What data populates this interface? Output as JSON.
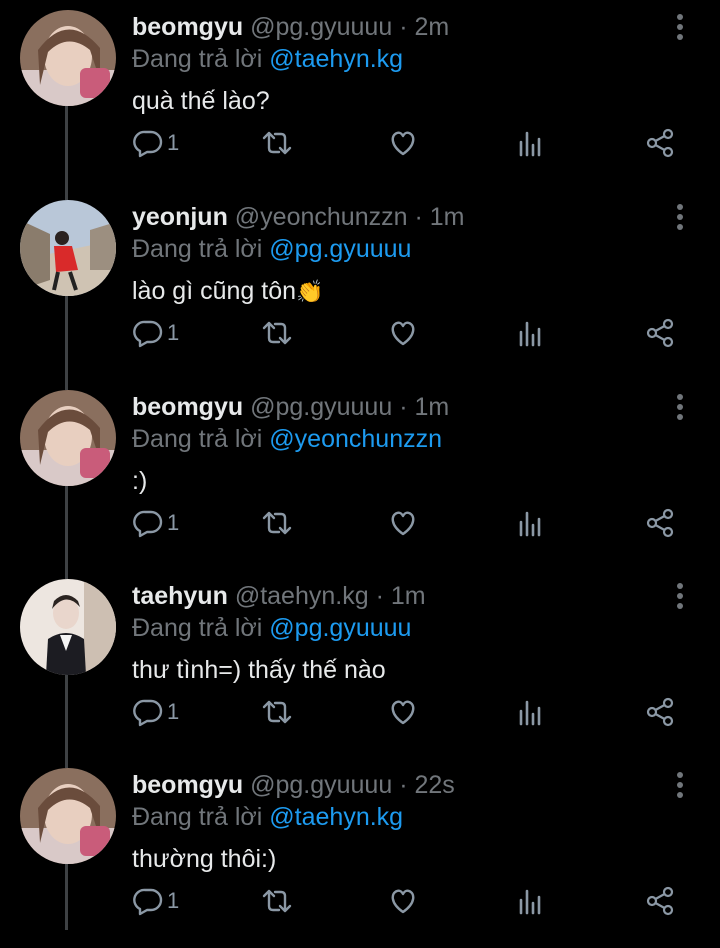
{
  "colors": {
    "background": "#000000",
    "text": "#e7e9ea",
    "muted": "#71767b",
    "mention": "#1d9bf0",
    "thread_line": "#3e4144"
  },
  "icons": [
    "reply-icon",
    "retweet-icon",
    "like-icon",
    "views-icon",
    "share-icon",
    "more-icon"
  ],
  "tweets": [
    {
      "name": "beomgyu",
      "handle": "@pg.gyuuuu",
      "sep": "·",
      "time": "2m",
      "reply_prefix": "Đang trả lời",
      "reply_to": "@taehyn.kg",
      "text": "quà thế lào?",
      "reply_count": "1"
    },
    {
      "name": "yeonjun",
      "handle": "@yeonchunzzn",
      "sep": "·",
      "time": "1m",
      "reply_prefix": "Đang trả lời",
      "reply_to": "@pg.gyuuuu",
      "text": "lào gì cũng tôn",
      "emoji": "👏",
      "reply_count": "1"
    },
    {
      "name": "beomgyu",
      "handle": "@pg.gyuuuu",
      "sep": "·",
      "time": "1m",
      "reply_prefix": "Đang trả lời",
      "reply_to": "@yeonchunzzn",
      "text": ":)",
      "reply_count": "1"
    },
    {
      "name": "taehyun",
      "handle": "@taehyn.kg",
      "sep": "·",
      "time": "1m",
      "reply_prefix": "Đang trả lời",
      "reply_to": "@pg.gyuuuu",
      "text": "thư tình=) thấy thế nào",
      "reply_count": "1"
    },
    {
      "name": "beomgyu",
      "handle": "@pg.gyuuuu",
      "sep": "·",
      "time": "22s",
      "reply_prefix": "Đang trả lời",
      "reply_to": "@taehyn.kg",
      "text": "thường thôi:)",
      "reply_count": "1"
    }
  ]
}
